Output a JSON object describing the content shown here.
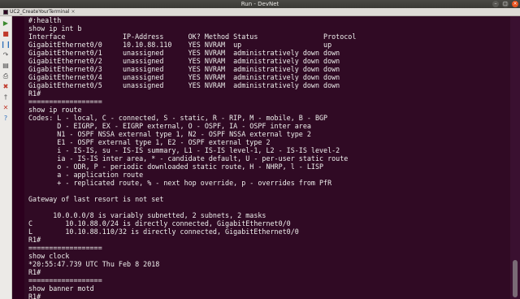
{
  "window": {
    "title": "Run - DevNet"
  },
  "tab": {
    "label": "UC2_CreateYourTerminal"
  },
  "sidebar": {
    "buttons": [
      {
        "name": "run-icon",
        "glyph": "▶",
        "color": "#3b8a2e"
      },
      {
        "name": "stop-icon",
        "glyph": "■",
        "color": "#c0392b"
      },
      {
        "name": "pause-icon",
        "glyph": "❙❙",
        "color": "#2e6fba"
      },
      {
        "name": "step-icon",
        "glyph": "↷",
        "color": "#555555"
      },
      {
        "name": "console-icon",
        "glyph": "▤",
        "color": "#444444"
      },
      {
        "name": "print-icon",
        "glyph": "⎙",
        "color": "#444444"
      },
      {
        "name": "delete-icon",
        "glyph": "✖",
        "color": "#c0392b"
      },
      {
        "name": "pin-icon",
        "glyph": "†",
        "color": "#555555"
      },
      {
        "name": "clear-icon",
        "glyph": "✕",
        "color": "#c0392b"
      },
      {
        "name": "help-icon",
        "glyph": "?",
        "color": "#2e6fba"
      }
    ]
  },
  "terminal": {
    "lines": [
      "#:health",
      "show ip int b",
      "Interface              IP-Address      OK? Method Status                Protocol",
      "GigabitEthernet0/0     10.10.88.110    YES NVRAM  up                    up",
      "GigabitEthernet0/1     unassigned      YES NVRAM  administratively down down",
      "GigabitEthernet0/2     unassigned      YES NVRAM  administratively down down",
      "GigabitEthernet0/3     unassigned      YES NVRAM  administratively down down",
      "GigabitEthernet0/4     unassigned      YES NVRAM  administratively down down",
      "GigabitEthernet0/5     unassigned      YES NVRAM  administratively down down",
      "R1#",
      "==================",
      "show ip route",
      "Codes: L - local, C - connected, S - static, R - RIP, M - mobile, B - BGP",
      "       D - EIGRP, EX - EIGRP external, O - OSPF, IA - OSPF inter area",
      "       N1 - OSPF NSSA external type 1, N2 - OSPF NSSA external type 2",
      "       E1 - OSPF external type 1, E2 - OSPF external type 2",
      "       i - IS-IS, su - IS-IS summary, L1 - IS-IS level-1, L2 - IS-IS level-2",
      "       ia - IS-IS inter area, * - candidate default, U - per-user static route",
      "       o - ODR, P - periodic downloaded static route, H - NHRP, l - LISP",
      "       a - application route",
      "       + - replicated route, % - next hop override, p - overrides from PfR",
      "",
      "Gateway of last resort is not set",
      "",
      "      10.0.0.0/8 is variably subnetted, 2 subnets, 2 masks",
      "C        10.10.88.0/24 is directly connected, GigabitEthernet0/0",
      "L        10.10.88.110/32 is directly connected, GigabitEthernet0/0",
      "R1#",
      "==================",
      "show clock",
      "*20:55:47.739 UTC Thu Feb 8 2018",
      "R1#",
      "==================",
      "show banner motd",
      "R1#"
    ]
  }
}
